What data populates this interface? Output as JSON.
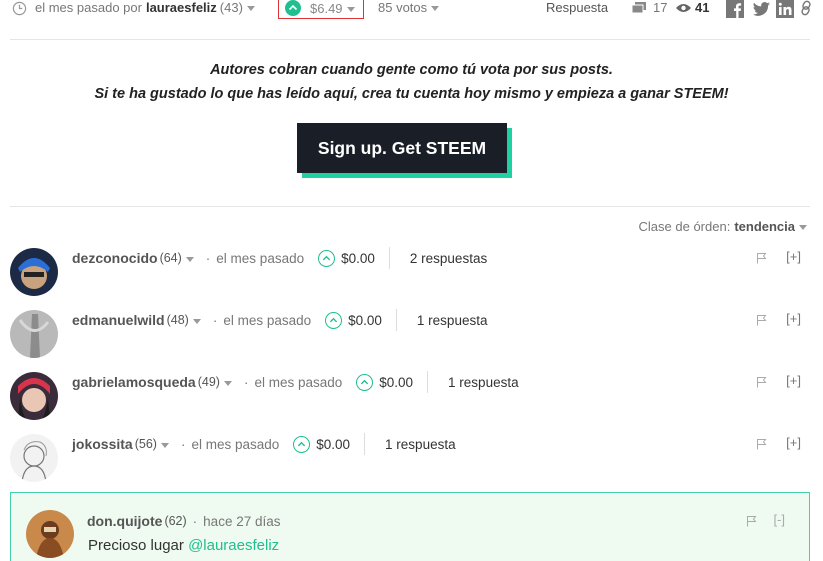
{
  "post_meta": {
    "time": "el mes pasado por",
    "author": "lauraesfeliz",
    "author_rep": "(43)",
    "payout": "$6.49",
    "votes": "85 votos",
    "reply_label": "Respuesta",
    "comment_count": "17",
    "view_count": "41"
  },
  "promo": {
    "line1": "Autores cobran cuando gente como tú vota por sus posts.",
    "line2": "Si te ha gustado lo que has leído aquí, crea tu cuenta hoy mismo y empieza a ganar STEEM!",
    "signup_label": "Sign up. Get STEEM"
  },
  "sort": {
    "label": "Clase de órden:",
    "value": "tendencia"
  },
  "comments": [
    {
      "author": "dezconocido",
      "rep": "(64)",
      "time": "el mes pasado",
      "payout": "$0.00",
      "replies": "2 respuestas",
      "expand": "[+]"
    },
    {
      "author": "edmanuelwild",
      "rep": "(48)",
      "time": "el mes pasado",
      "payout": "$0.00",
      "replies": "1 respuesta",
      "expand": "[+]"
    },
    {
      "author": "gabrielamosqueda",
      "rep": "(49)",
      "time": "el mes pasado",
      "payout": "$0.00",
      "replies": "1 respuesta",
      "expand": "[+]"
    },
    {
      "author": "jokossita",
      "rep": "(56)",
      "time": "el mes pasado",
      "payout": "$0.00",
      "replies": "1 respuesta",
      "expand": "[+]"
    }
  ],
  "reply": {
    "author": "don.quijote",
    "rep": "(62)",
    "time": "hace 27 días",
    "body_text": "Precioso lugar",
    "mention": "@lauraesfeliz",
    "collapse": "[-]"
  },
  "colors": {
    "accent": "#1fbf8f",
    "button_dark": "#1a1f27",
    "button_shadow": "#1fd1a1",
    "highlight_border": "#d33"
  }
}
